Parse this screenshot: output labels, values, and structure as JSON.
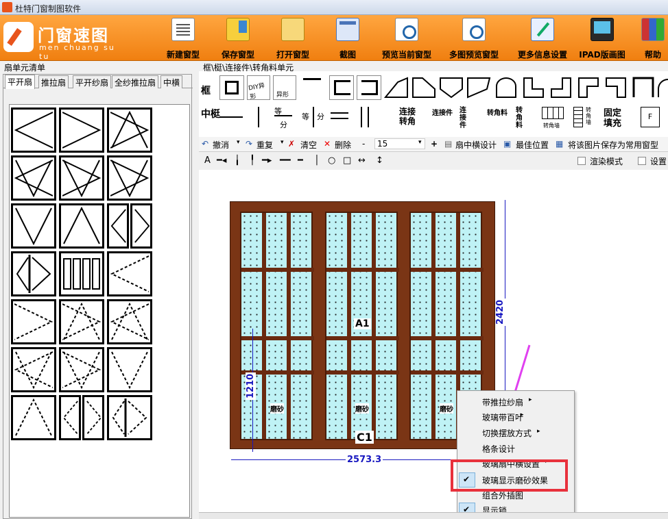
{
  "window": {
    "title": "杜特门窗制图软件"
  },
  "logo": {
    "title": "门窗速图",
    "subtitle": "men chuang su tu"
  },
  "toolbar": {
    "items": [
      "新建窗型",
      "保存窗型",
      "打开窗型",
      "截图",
      "预览当前窗型",
      "多图预览窗型",
      "更多信息设置",
      "IPAD版画图",
      "帮助"
    ]
  },
  "left_panel": {
    "title": "扇单元清单",
    "tabs": [
      "平开扇",
      "推拉扇",
      "平开纱扇",
      "全纱推拉扇",
      "中横"
    ],
    "active_tab": "平开扇"
  },
  "top_panel": {
    "title": "框\\梃\\连接件\\转角料单元",
    "row1_label": "框",
    "row2_label": "中梃",
    "labels": {
      "diy": "DIY异形",
      "special": "异形",
      "eq": "等",
      "fen": "分",
      "eq2": "等",
      "fen2": "分",
      "lian": "连接转角",
      "lianjj": "连接件",
      "lianjj2": "连接件",
      "zhuanjl": "转角料",
      "zhuanjl2": "转角料",
      "zhuanjq": "转角墙",
      "zhuanjq2": "转角墙",
      "guding": "固定填充",
      "f": "F"
    }
  },
  "edit_toolbar": {
    "undo": "撤消",
    "redo": "重复",
    "clear": "清空",
    "delete": "删除",
    "minus": "-",
    "value": "15",
    "plus": "+",
    "mid_design": "扇中横设计",
    "best_pos": "最佳位置",
    "save_common": "将该图片保存为常用窗型"
  },
  "draw_toolbar": {
    "text_tool": "A",
    "render_mode": "渲染模式",
    "settings": "设置"
  },
  "drawing": {
    "width_dim": "2573.3",
    "height_dim": "2420",
    "sub_height_dim": "1210",
    "label_a1": "A1",
    "label_c1": "C1",
    "frost": [
      "磨砂",
      "磨砂",
      "磨砂"
    ]
  },
  "context_menu": {
    "items": [
      "带推拉纱扇",
      "玻璃带百叶",
      "切换摆放方式",
      "格条设计",
      "玻璃扇中横设置",
      "玻璃显示磨砂效果",
      "组合外插图",
      "显示锁"
    ],
    "checked": [
      "玻璃显示磨砂效果",
      "显示锁"
    ]
  },
  "colors": {
    "ribbon": "#f28a1e",
    "frame": "#7a3515",
    "glass": "#bff2f5",
    "highlight": "#e8313c",
    "arrow": "#e040f0"
  }
}
